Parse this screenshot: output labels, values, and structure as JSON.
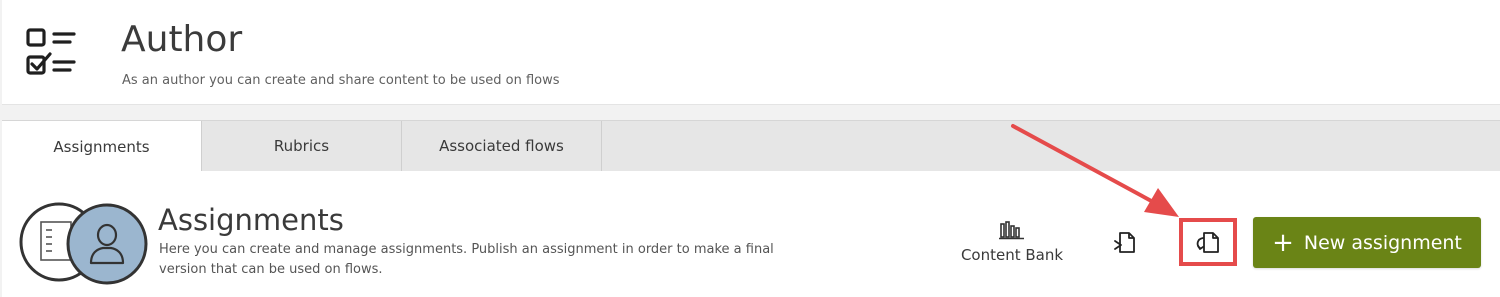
{
  "header": {
    "title": "Author",
    "subtitle": "As an author you can create and share content to be used on flows",
    "icon": "checklist-icon"
  },
  "tabs": [
    {
      "label": "Assignments",
      "active": true
    },
    {
      "label": "Rubrics",
      "active": false
    },
    {
      "label": "Associated flows",
      "active": false
    }
  ],
  "section": {
    "title": "Assignments",
    "description": "Here you can create and manage assignments. Publish an assignment in order to make a final version that can be used on flows."
  },
  "toolbar": {
    "content_bank_label": "Content Bank",
    "content_bank_icon": "library-books-icon",
    "import_icon": "document-import-icon",
    "share_icon": "document-share-icon",
    "new_assignment_label": "New assignment"
  },
  "annotation": {
    "color": "#e54b4b",
    "target": "share-icon-button"
  },
  "colors": {
    "primary_button": "#6a8416",
    "avatar_bg": "#9bb6cf"
  }
}
